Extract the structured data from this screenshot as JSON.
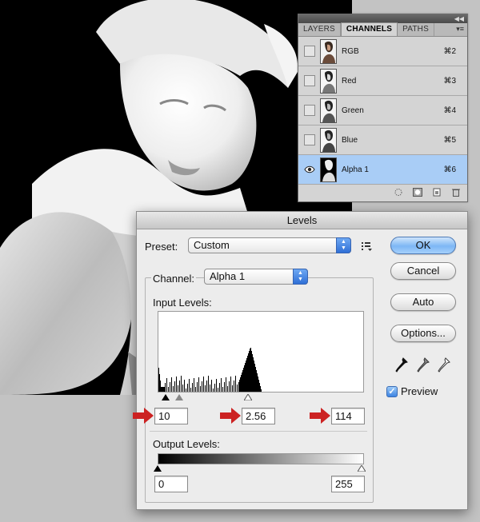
{
  "channels_panel": {
    "tabs": [
      "LAYERS",
      "CHANNELS",
      "PATHS"
    ],
    "active_tab": "CHANNELS",
    "rows": [
      {
        "name": "RGB",
        "shortcut": "⌘2",
        "visible": false,
        "selected": false
      },
      {
        "name": "Red",
        "shortcut": "⌘3",
        "visible": false,
        "selected": false
      },
      {
        "name": "Green",
        "shortcut": "⌘4",
        "visible": false,
        "selected": false
      },
      {
        "name": "Blue",
        "shortcut": "⌘5",
        "visible": false,
        "selected": false
      },
      {
        "name": "Alpha 1",
        "shortcut": "⌘6",
        "visible": true,
        "selected": true
      }
    ],
    "footer_icons": [
      "dotted-circle-icon",
      "mask-circle-icon",
      "new-channel-icon",
      "trash-icon"
    ]
  },
  "levels": {
    "title": "Levels",
    "preset_label": "Preset:",
    "preset_value": "Custom",
    "channel_label": "Channel:",
    "channel_value": "Alpha 1",
    "input_levels_label": "Input Levels:",
    "input_black": "10",
    "input_gamma": "2.56",
    "input_white": "114",
    "output_levels_label": "Output Levels:",
    "output_black": "0",
    "output_white": "255",
    "buttons": {
      "ok": "OK",
      "cancel": "Cancel",
      "auto": "Auto",
      "options": "Options..."
    },
    "preview_label": "Preview",
    "preview_checked": true,
    "accent_color": "#3d84e2",
    "arrow_color": "#cc2222"
  }
}
